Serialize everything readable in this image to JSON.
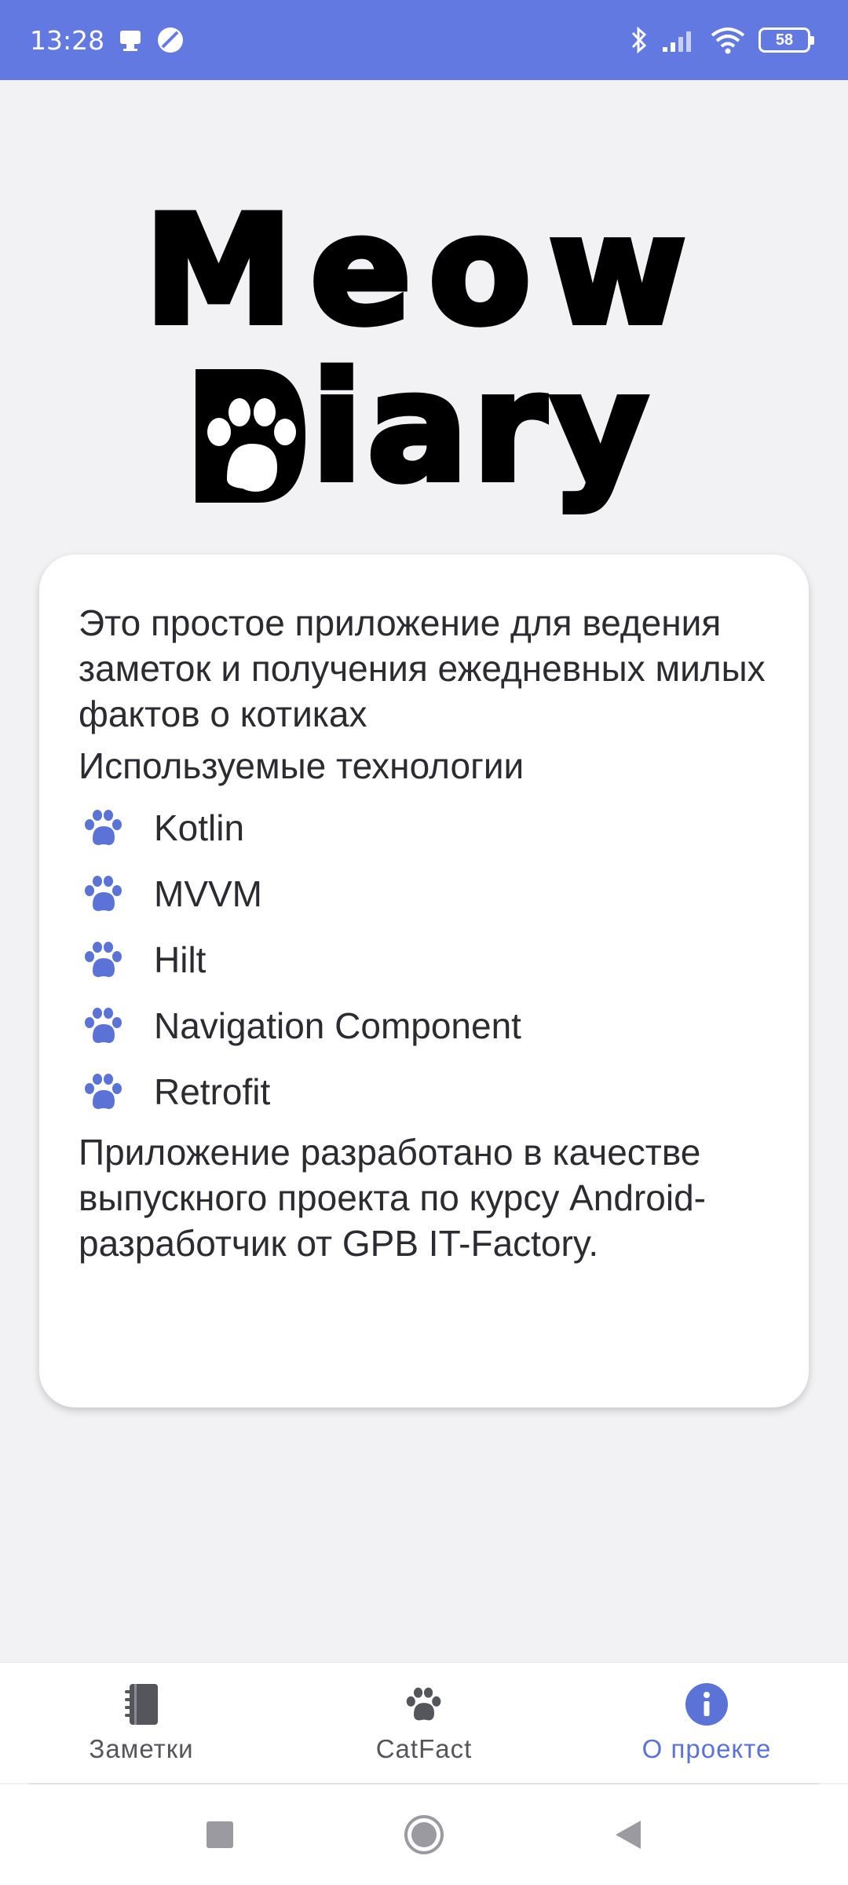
{
  "status_bar": {
    "time": "13:28",
    "battery": "58",
    "icons": [
      "notification-icon",
      "vpn-icon",
      "bluetooth-icon",
      "signal-icon",
      "wifi-icon",
      "battery-icon"
    ]
  },
  "logo": {
    "line1": "Meow",
    "line2": "iary"
  },
  "card": {
    "description": "Это простое приложение для ведения заметок и получения ежедневных милых фактов о котиках",
    "tech_heading": "Используемые технологии",
    "technologies": [
      "Kotlin",
      "MVVM",
      "Hilt",
      "Navigation Component",
      "Retrofit"
    ],
    "footer": "Приложение разработано в качестве выпускного проекта по курсу Android-разработчик от GPB IT-Factory."
  },
  "bottom_nav": {
    "items": [
      {
        "label": "Заметки",
        "icon": "notebook-icon",
        "active": false
      },
      {
        "label": "CatFact",
        "icon": "paw-icon",
        "active": false
      },
      {
        "label": "О проекте",
        "icon": "info-icon",
        "active": true
      }
    ]
  },
  "colors": {
    "accent": "#5b72d6",
    "status_bar": "#6279e2",
    "background": "#f2f2f4",
    "text": "#2b2b31"
  }
}
